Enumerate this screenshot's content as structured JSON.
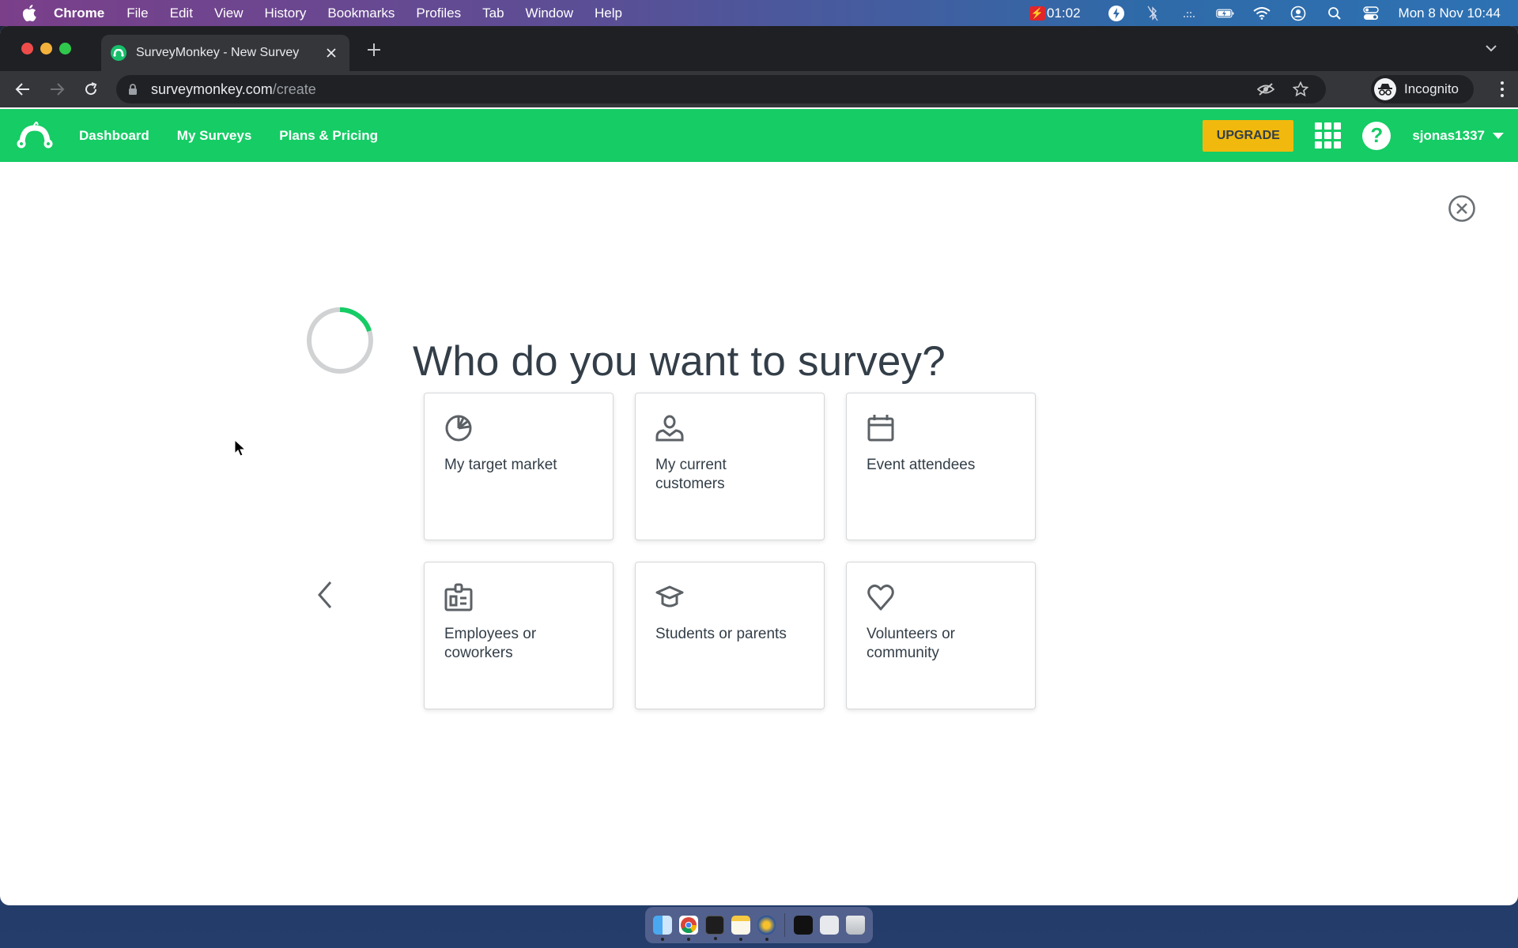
{
  "menubar": {
    "app_name": "Chrome",
    "items": [
      "File",
      "Edit",
      "View",
      "History",
      "Bookmarks",
      "Profiles",
      "Tab",
      "Window",
      "Help"
    ],
    "recording_time": "01:02",
    "datetime": "Mon 8 Nov  10:44"
  },
  "browser": {
    "tab_title": "SurveyMonkey - New Survey",
    "new_tab_label": "+",
    "url_host": "surveymonkey.com",
    "url_path": "/create",
    "profile_label": "Incognito"
  },
  "header": {
    "nav": [
      "Dashboard",
      "My Surveys",
      "Plans & Pricing"
    ],
    "upgrade_label": "UPGRADE",
    "help_label": "?",
    "username": "sjonas1337",
    "brand_color": "#15cc65",
    "upgrade_color": "#f1b90d"
  },
  "main": {
    "heading": "Who do you want to survey?",
    "progress": 0.2,
    "cards": [
      {
        "icon": "pie-chart-icon",
        "label": "My target market"
      },
      {
        "icon": "person-icon",
        "label": "My current customers"
      },
      {
        "icon": "calendar-icon",
        "label": "Event attendees"
      },
      {
        "icon": "id-badge-icon",
        "label": "Employees or coworkers"
      },
      {
        "icon": "graduation-cap-icon",
        "label": "Students or parents"
      },
      {
        "icon": "heart-icon",
        "label": "Volunteers or community"
      }
    ]
  },
  "dock": {
    "apps": [
      "Finder",
      "Chrome",
      "Terminal",
      "Notes",
      "Reeder",
      "Screenshot",
      "Preview",
      "Trash"
    ]
  }
}
